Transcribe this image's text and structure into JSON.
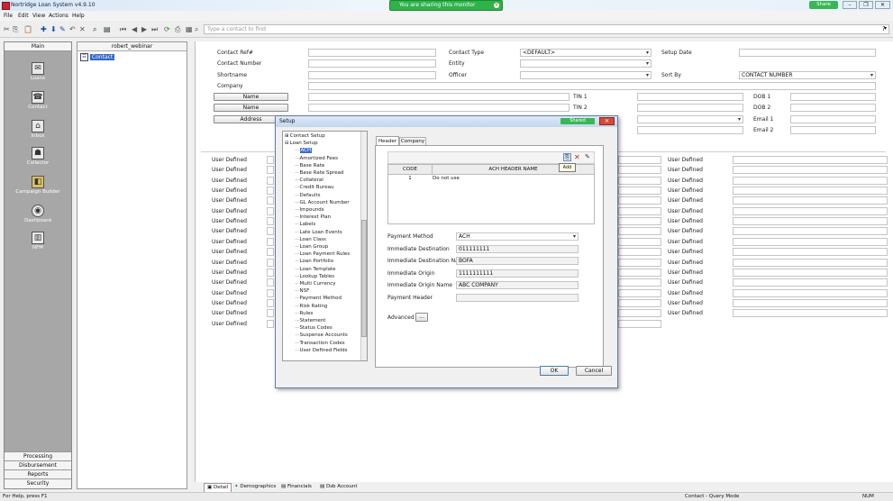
{
  "app": {
    "title": "Nortridge Loan System v4.9.10"
  },
  "sharing_banner": {
    "text": "You are sharing this monitor"
  },
  "window_controls": {
    "share": "Share"
  },
  "menu": [
    "File",
    "Edit",
    "View",
    "Actions",
    "Help"
  ],
  "search": {
    "placeholder": "Type a contact to find"
  },
  "left_nav": {
    "header": "Main",
    "items": [
      {
        "label": "Loans",
        "icon": "loans-icon"
      },
      {
        "label": "Contact",
        "icon": "contact-icon"
      },
      {
        "label": "Inbox",
        "icon": "inbox-icon"
      },
      {
        "label": "Collector",
        "icon": "collector-icon"
      },
      {
        "label": "Campaign Builder",
        "icon": "campaign-builder-icon"
      },
      {
        "label": "Dashboard",
        "icon": "dashboard-icon"
      },
      {
        "label": "NFM",
        "icon": "nfm-icon"
      }
    ],
    "bottom_buttons": [
      "Processing",
      "Disbursement",
      "Reports",
      "Security"
    ]
  },
  "tree_panel": {
    "header": "robert_webinar",
    "selected": "Contact"
  },
  "contact_form": {
    "contact_ref": "Contact Ref#",
    "contact_number": "Contact Number",
    "shortname": "Shortname",
    "company": "Company",
    "name_btn1": "Name",
    "name_btn2": "Name",
    "address_btn": "Address",
    "contact_type": "Contact Type",
    "contact_type_value": "<DEFAULT>",
    "entity": "Entity",
    "officer": "Officer",
    "setup_date": "Setup Date",
    "sort_by": "Sort By",
    "sort_by_value": "CONTACT NUMBER",
    "tin1": "TIN 1",
    "tin2": "TIN 2",
    "dob1": "DOB 1",
    "dob2": "DOB 2",
    "email1": "Email 1",
    "email2": "Email 2"
  },
  "user_defined_label": "User Defined",
  "bottom_tabs": [
    "Detail",
    "Demographics",
    "Financials",
    "Dsb Account"
  ],
  "status": {
    "left": "For Help, press F1",
    "right": "Contact - Query Mode",
    "far_right": "NUM"
  },
  "dialog": {
    "title": "Setup",
    "badge": "Shared",
    "tree_items": [
      {
        "label": "Contact Setup",
        "level": 0,
        "expander": "⊞"
      },
      {
        "label": "Loan Setup",
        "level": 0,
        "expander": "⊟"
      },
      {
        "label": "ACH",
        "level": 1,
        "selected": true
      },
      {
        "label": "Amortized Fees",
        "level": 1
      },
      {
        "label": "Base Rate",
        "level": 1
      },
      {
        "label": "Base Rate Spread",
        "level": 1
      },
      {
        "label": "Collateral",
        "level": 1
      },
      {
        "label": "Credit Bureau",
        "level": 1
      },
      {
        "label": "Defaults",
        "level": 1
      },
      {
        "label": "GL Account Number",
        "level": 1
      },
      {
        "label": "Impounds",
        "level": 1
      },
      {
        "label": "Interest Plan",
        "level": 1
      },
      {
        "label": "Labels",
        "level": 1
      },
      {
        "label": "Late Loan Events",
        "level": 1
      },
      {
        "label": "Loan Class",
        "level": 1
      },
      {
        "label": "Loan Group",
        "level": 1
      },
      {
        "label": "Loan Payment Rules",
        "level": 1
      },
      {
        "label": "Loan Portfolio",
        "level": 1
      },
      {
        "label": "Loan Template",
        "level": 1
      },
      {
        "label": "Lookup Tables",
        "level": 1
      },
      {
        "label": "Multi Currency",
        "level": 1
      },
      {
        "label": "NSF",
        "level": 1
      },
      {
        "label": "Payment Method",
        "level": 1
      },
      {
        "label": "Risk Rating",
        "level": 1
      },
      {
        "label": "Rules",
        "level": 1
      },
      {
        "label": "Statement",
        "level": 1
      },
      {
        "label": "Status Codes",
        "level": 1
      },
      {
        "label": "Suspense Accounts",
        "level": 1
      },
      {
        "label": "Transaction Codes",
        "level": 1
      },
      {
        "label": "User Defined Fields",
        "level": 1
      }
    ],
    "tabs": [
      "Header",
      "Company"
    ],
    "active_tab": "Header",
    "toolbar_tooltip": "Add",
    "grid": {
      "columns": [
        "CODE",
        "ACH HEADER NAME"
      ],
      "rows": [
        [
          "1",
          "Do not use"
        ]
      ]
    },
    "fields": {
      "payment_method_label": "Payment Method",
      "payment_method_value": "ACH",
      "immediate_destination_label": "Immediate Destination",
      "immediate_destination_value": "011111111",
      "immediate_destination_name_label": "Immediate Destination Name",
      "immediate_destination_name_value": "BOFA",
      "immediate_origin_label": "Immediate Origin",
      "immediate_origin_value": "1111111111",
      "immediate_origin_name_label": "Immediate Origin Name",
      "immediate_origin_name_value": "ABC COMPANY",
      "payment_header_label": "Payment Header",
      "advanced_label": "Advanced",
      "advanced_btn": "..."
    },
    "ok": "OK",
    "cancel": "Cancel"
  }
}
